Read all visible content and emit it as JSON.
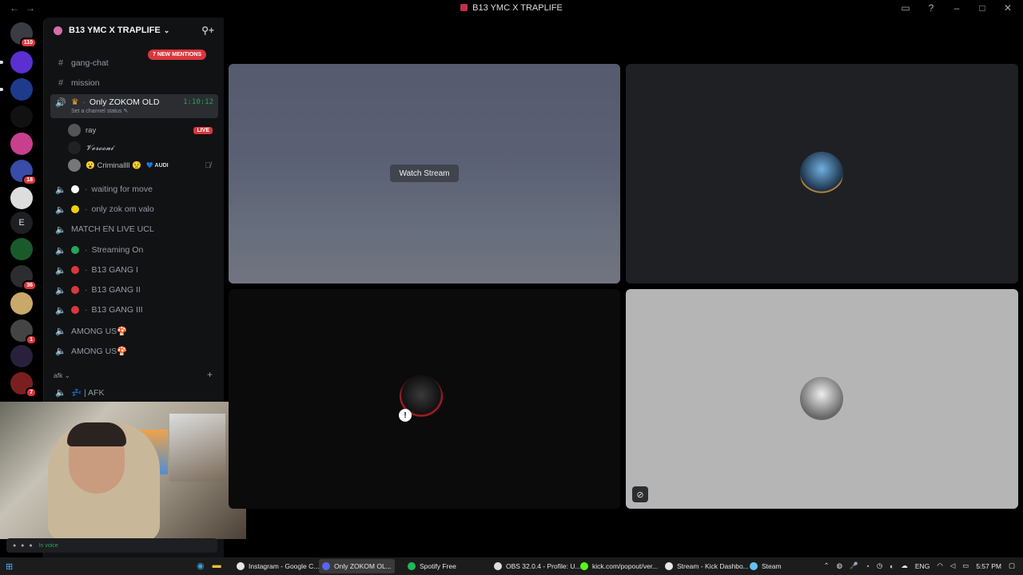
{
  "window": {
    "title": "B13 YMC X TRAPLIFE",
    "nav_back": "←",
    "nav_fwd": "→"
  },
  "rail": {
    "badges": [
      "110",
      "18",
      "36",
      "1",
      "7"
    ],
    "letter_server": "E"
  },
  "guild": {
    "name": "B13 YMC X TRAPLIFE"
  },
  "sidebar": {
    "mentions_pill": "7 NEW MENTIONS",
    "text_channels": [
      {
        "name": "gang-chat"
      },
      {
        "name": "mission"
      }
    ],
    "active_voice": {
      "name": "Only ZOKOM OLD",
      "timer": "1:10:12",
      "status_placeholder": "Set a channel status ✎",
      "users": [
        {
          "name": "ray",
          "live_label": "LIVE"
        },
        {
          "name": "𝓥𝓮𝓻𝓸𝓸𝓷𝓲"
        },
        {
          "name": "😮 Criminallll 😟",
          "tag": "💙 AUDI"
        }
      ]
    },
    "voice_channels": [
      {
        "name": "waiting for move",
        "dot": "#ffffff"
      },
      {
        "name": "only zok om valo",
        "dot": "#f0d000"
      },
      {
        "name": "MATCH EN LIVE UCL",
        "dot": ""
      },
      {
        "name": "Streaming On",
        "dot": "#23a55a"
      },
      {
        "name": "B13 GANG I",
        "dot": "#da373c"
      },
      {
        "name": "B13 GANG II",
        "dot": "#da373c"
      },
      {
        "name": "B13 GANG III",
        "dot": "#da373c"
      },
      {
        "name": "AMONG US🍄",
        "dot": ""
      },
      {
        "name": "AMONG US🍄",
        "dot": ""
      }
    ],
    "category": "afk",
    "afk_channel": "💤 | AFK"
  },
  "voicebar": {
    "text": "In voice"
  },
  "stream": {
    "watch_label": "Watch Stream"
  },
  "taskbar": {
    "items": [
      {
        "label": "Instagram - Google C...",
        "color": "#e6e6e6"
      },
      {
        "label": "Only ZOKOM OL...",
        "color": "#5865f2"
      },
      {
        "label": "Spotify Free",
        "color": "#1db954"
      },
      {
        "label": "OBS 32.0.4 - Profile: U...",
        "color": "#dddddd"
      },
      {
        "label": "kick.com/popout/ver...",
        "color": "#53fc18"
      },
      {
        "label": "Stream - Kick Dashbo...",
        "color": "#e6e6e6"
      },
      {
        "label": "Steam",
        "color": "#66c0f4"
      }
    ],
    "lang": "ENG",
    "time": "5:57 PM"
  }
}
